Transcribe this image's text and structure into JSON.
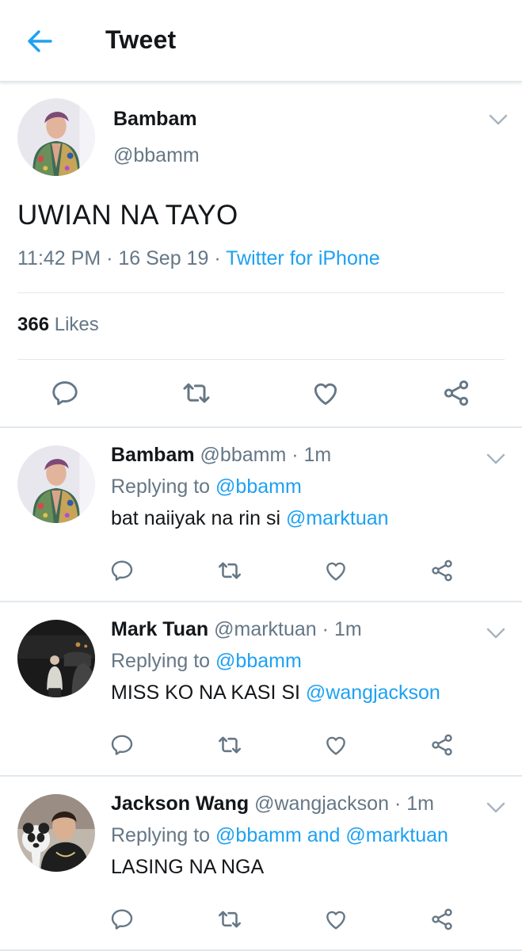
{
  "header": {
    "title": "Tweet"
  },
  "main_tweet": {
    "name": "Bambam",
    "handle": "@bbamm",
    "text": "UWIAN NA TAYO",
    "time": "11:42 PM",
    "date": "16 Sep 19",
    "source": "Twitter for iPhone",
    "likes_count": "366",
    "likes_label": "Likes"
  },
  "replies": [
    {
      "name": "Bambam",
      "handle": "@bbamm",
      "time": "1m",
      "replying_label": "Replying to",
      "replying_to": "@bbamm",
      "text": "bat naiiyak na rin si ",
      "mention": "@marktuan"
    },
    {
      "name": "Mark Tuan",
      "handle": "@marktuan",
      "time": "1m",
      "replying_label": "Replying to",
      "replying_to": "@bbamm",
      "text": "MISS KO NA KASI SI ",
      "mention": "@wangjackson"
    },
    {
      "name": "Jackson Wang",
      "handle": "@wangjackson",
      "time": "1m",
      "replying_label": "Replying to",
      "replying_to": "@bbamm and @marktuan",
      "text": "LASING NA NGA",
      "mention": ""
    }
  ],
  "colors": {
    "accent": "#1da1f2",
    "secondary_text": "#657786",
    "divider": "#e1e8ed"
  },
  "icons": [
    "back-arrow-icon",
    "chevron-down-icon",
    "reply-icon",
    "retweet-icon",
    "like-icon",
    "share-icon"
  ]
}
